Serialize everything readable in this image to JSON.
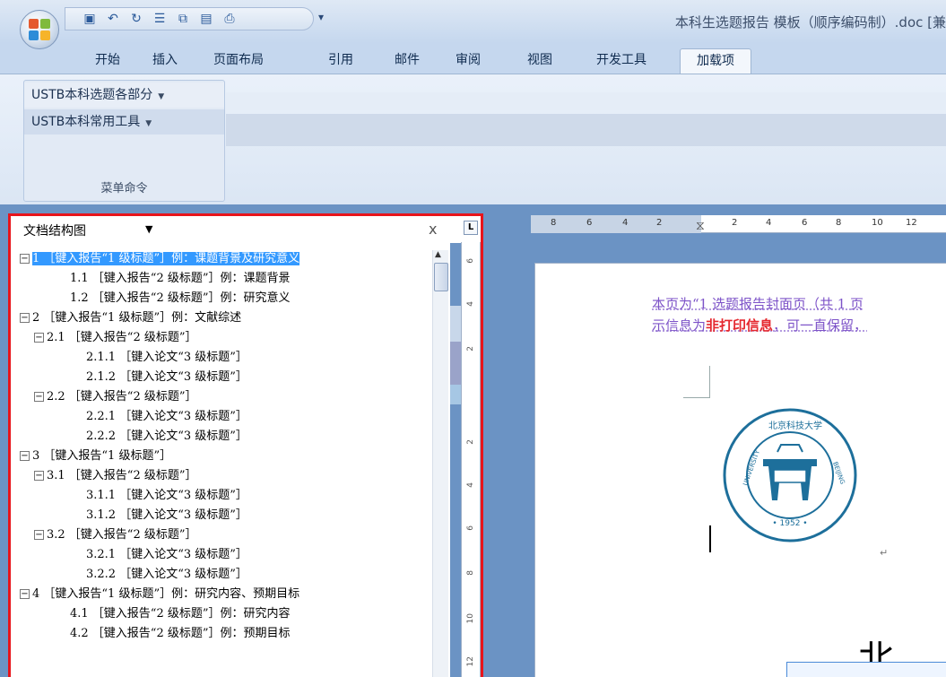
{
  "window": {
    "title": "本科生选题报告 模板（顺序编码制）.doc [兼"
  },
  "quick_access": {
    "icons": [
      "save-icon",
      "undo-icon",
      "redo-icon",
      "paragraph-icon",
      "open-icon",
      "new-icon",
      "print-icon"
    ],
    "customize": "▾"
  },
  "tabs": [
    "开始",
    "插入",
    "页面布局",
    "引用",
    "邮件",
    "审阅",
    "视图",
    "开发工具",
    "加载项"
  ],
  "active_tab": "加载项",
  "ribbon": {
    "menu_1": "USTB本科选题各部分",
    "menu_2": "USTB本科常用工具",
    "group_label": "菜单命令"
  },
  "document_map": {
    "title": "文档结构图",
    "dropdown": "▼",
    "close": "x",
    "items": [
      {
        "level": 1,
        "toggle": "⊟",
        "text": "1 ［键入报告“1 级标题”］例：课题背景及研究意义",
        "selected": true
      },
      {
        "level": 2,
        "toggle": "",
        "text": "1.1 ［键入报告“2 级标题”］例：课题背景"
      },
      {
        "level": 2,
        "toggle": "",
        "text": "1.2 ［键入报告“2 级标题”］例：研究意义"
      },
      {
        "level": 1,
        "toggle": "⊟",
        "text": "2 ［键入报告“1 级标题”］例：文献综述"
      },
      {
        "level": 2,
        "toggle": "⊟",
        "text": "2.1 ［键入报告“2 级标题”］"
      },
      {
        "level": 3,
        "toggle": "",
        "text": "2.1.1 ［键入论文“3 级标题”］"
      },
      {
        "level": 3,
        "toggle": "",
        "text": "2.1.2 ［键入论文“3 级标题”］"
      },
      {
        "level": 2,
        "toggle": "⊟",
        "text": "2.2 ［键入报告“2 级标题”］"
      },
      {
        "level": 3,
        "toggle": "",
        "text": "2.2.1 ［键入论文“3 级标题”］"
      },
      {
        "level": 3,
        "toggle": "",
        "text": "2.2.2 ［键入论文“3 级标题”］"
      },
      {
        "level": 1,
        "toggle": "⊟",
        "text": "3 ［键入报告“1 级标题”］"
      },
      {
        "level": 2,
        "toggle": "⊟",
        "text": "3.1 ［键入报告“2 级标题”］"
      },
      {
        "level": 3,
        "toggle": "",
        "text": "3.1.1 ［键入论文“3 级标题”］"
      },
      {
        "level": 3,
        "toggle": "",
        "text": "3.1.2 ［键入论文“3 级标题”］"
      },
      {
        "level": 2,
        "toggle": "⊟",
        "text": "3.2 ［键入报告“2 级标题”］"
      },
      {
        "level": 3,
        "toggle": "",
        "text": "3.2.1 ［键入论文“3 级标题”］"
      },
      {
        "level": 3,
        "toggle": "",
        "text": "3.2.2 ［键入论文“3 级标题”］"
      },
      {
        "level": 1,
        "toggle": "⊟",
        "text": "4 ［键入报告“1 级标题”］例：研究内容、预期目标"
      },
      {
        "level": 2,
        "toggle": "",
        "text": "4.1 ［键入报告“2 级标题”］例：研究内容"
      },
      {
        "level": 2,
        "toggle": "",
        "text": "4.2 ［键入报告“2 级标题”］例：预期目标"
      }
    ]
  },
  "ruler": {
    "horizontal": [
      "8",
      "6",
      "4",
      "2",
      "2",
      "4",
      "6",
      "8",
      "10",
      "12"
    ],
    "vertical": [
      "6",
      "4",
      "2",
      "2",
      "4",
      "6",
      "8",
      "10",
      "12"
    ],
    "tab_selector": "L"
  },
  "page": {
    "hint_line1": "本页为“1 选题报告封面页（共 1 页",
    "hint_line2_a": "示信息为",
    "hint_line2_b": "非打印信息",
    "hint_line2_c": "，可一直保留，",
    "seal_logo_text": "北京科技大学 UNIVERSITY OF SCIENCE AND TECHNOLOGY BEIJING 1952",
    "return_mark": "↵",
    "big_char": "北",
    "big_char_trail": "··"
  },
  "colors": {
    "highlight": "#e8141b",
    "selection": "#3399ff",
    "hint_text": "#7d53c8",
    "hint_emphasis": "#e5292f"
  }
}
